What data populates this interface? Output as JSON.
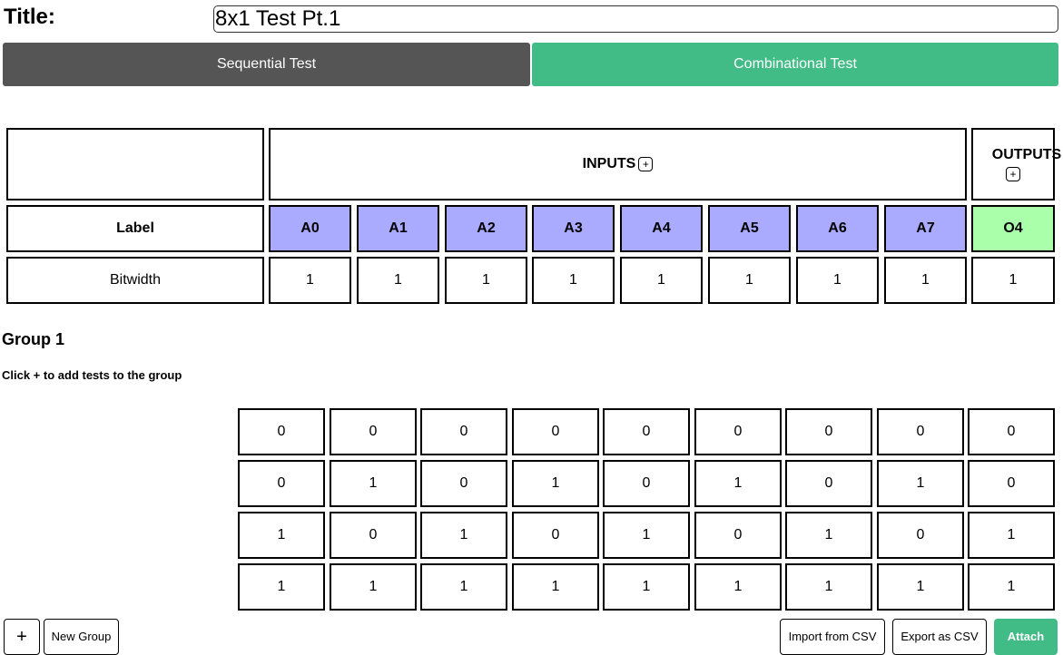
{
  "title": {
    "label": "Title:",
    "value": "8x1 Test Pt.1"
  },
  "modes": {
    "sequential": "Sequential Test",
    "combinational": "Combinational Test"
  },
  "table": {
    "inputs_label": "INPUTS",
    "outputs_label": "OUTPUTS",
    "plus": "+",
    "label_row_header": "Label",
    "bitwidth_row_header": "Bitwidth",
    "inputs": [
      "A0",
      "A1",
      "A2",
      "A3",
      "A4",
      "A5",
      "A6",
      "A7"
    ],
    "outputs": [
      "O4"
    ],
    "input_bitwidths": [
      "1",
      "1",
      "1",
      "1",
      "1",
      "1",
      "1",
      "1"
    ],
    "output_bitwidths": [
      "1"
    ]
  },
  "group": {
    "title": "Group 1",
    "hint": "Click + to add tests to the group",
    "rows": [
      [
        "0",
        "0",
        "0",
        "0",
        "0",
        "0",
        "0",
        "0",
        "0"
      ],
      [
        "0",
        "1",
        "0",
        "1",
        "0",
        "1",
        "0",
        "1",
        "0"
      ],
      [
        "1",
        "0",
        "1",
        "0",
        "1",
        "0",
        "1",
        "0",
        "1"
      ],
      [
        "1",
        "1",
        "1",
        "1",
        "1",
        "1",
        "1",
        "1",
        "1"
      ]
    ]
  },
  "footer": {
    "add": "+",
    "new_group": "New Group",
    "import_csv": "Import from CSV",
    "export_csv": "Export as CSV",
    "attach": "Attach"
  },
  "colors": {
    "input_header": "#aaaaff",
    "output_header": "#aaffaa",
    "accent": "#42bc87",
    "sequential": "#555555"
  }
}
